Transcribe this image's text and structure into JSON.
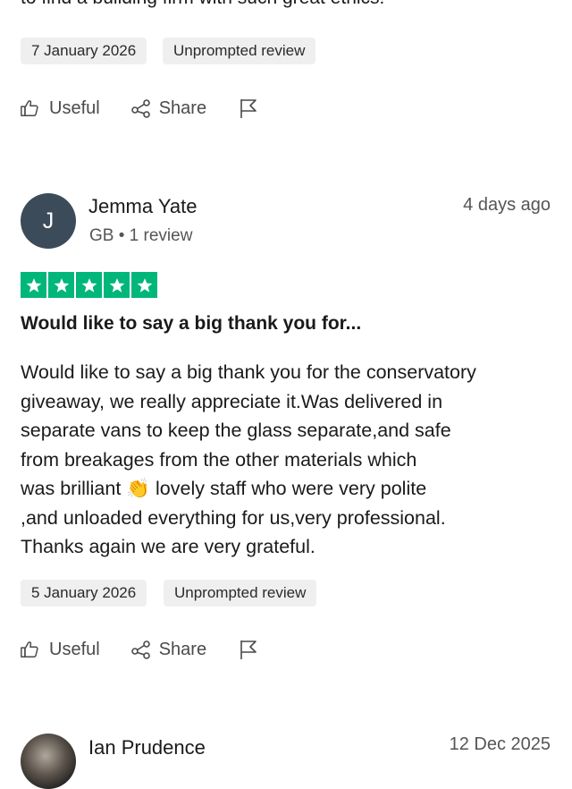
{
  "previous_review": {
    "text_tail": "to find a building firm with such great ethics!",
    "date": "7 January 2026",
    "tag": "Unprompted review"
  },
  "actions": {
    "useful": "Useful",
    "share": "Share"
  },
  "review": {
    "avatar_letter": "J",
    "avatar_color": "#3c4b5a",
    "name": "Jemma Yate",
    "meta": "GB • 1 review",
    "time": "4 days ago",
    "rating": 5,
    "star_color": "#00b67a",
    "title": "Would like to say a big thank you for...",
    "body_lines": [
      "Would like to say a big thank you for the conservatory",
      "giveaway, we really appreciate it.Was delivered in",
      "separate vans to keep the glass separate,and safe",
      "from breakages from the other materials which",
      "was brilliant 👏 lovely staff who were very polite",
      ",and unloaded everything for us,very professional.",
      "Thanks again we are very grateful."
    ],
    "date": "5 January 2026",
    "tag": "Unprompted review"
  },
  "next_review": {
    "name": "Ian Prudence",
    "time": "12 Dec 2025"
  }
}
